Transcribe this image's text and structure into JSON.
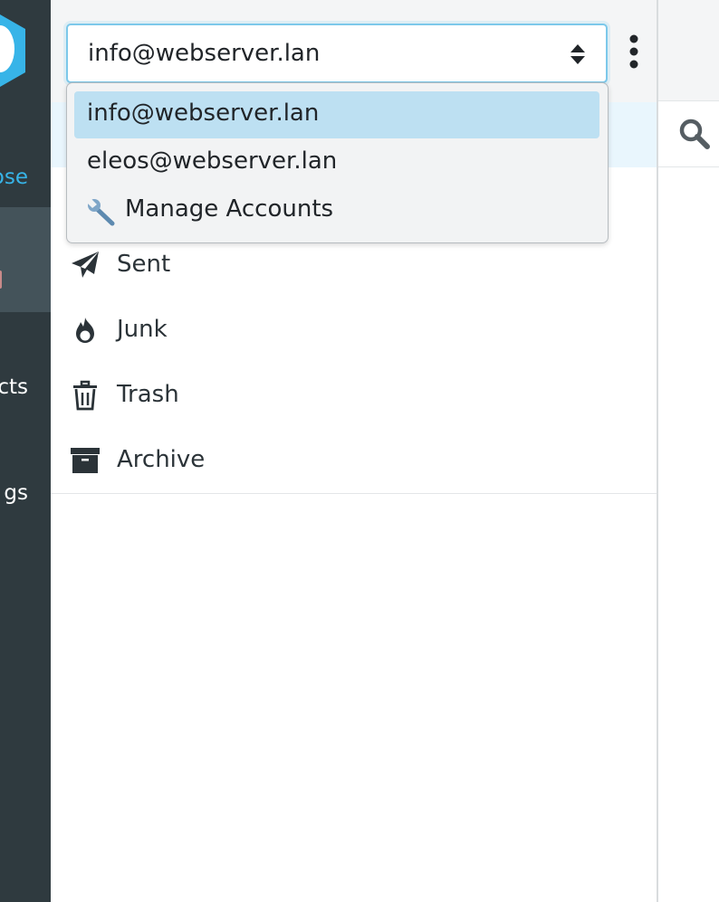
{
  "nav": {
    "compose_fragment": "ose",
    "contacts_fragment": "cts",
    "settings_fragment": "gs",
    "accent_color": "#37b4e8",
    "background_color": "#2f3a3f"
  },
  "account_selector": {
    "selected_value": "info@webserver.lan",
    "options": [
      {
        "label": "info@webserver.lan",
        "highlighted": true
      },
      {
        "label": "eleos@webserver.lan",
        "highlighted": false
      },
      {
        "label": "Manage Accounts",
        "icon": "wrench-icon",
        "highlighted": false
      }
    ]
  },
  "folders": [
    {
      "label": "Sent",
      "icon": "paper-plane-icon"
    },
    {
      "label": "Junk",
      "icon": "fire-icon"
    },
    {
      "label": "Trash",
      "icon": "trash-icon"
    },
    {
      "label": "Archive",
      "icon": "archive-box-icon"
    }
  ],
  "message_panel": {
    "search_icon": "search-icon"
  }
}
